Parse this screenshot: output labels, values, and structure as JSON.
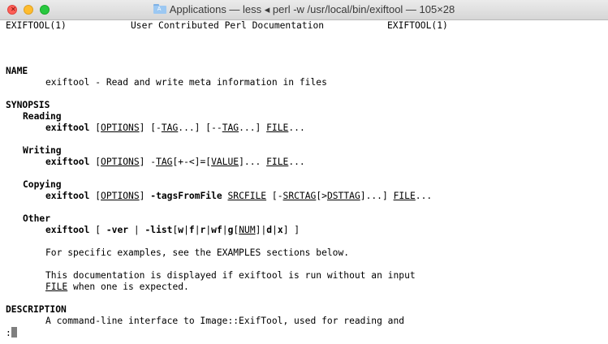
{
  "window": {
    "title": "Applications — less ◂ perl -w /usr/local/bin/exiftool — 105×28"
  },
  "terminal": {
    "header_left": "EXIFTOOL(1)",
    "header_center": "User Contributed Perl Documentation",
    "header_right": "EXIFTOOL(1)",
    "name_heading": "NAME",
    "name_text": "exiftool - Read and write meta information in files",
    "synopsis_heading": "SYNOPSIS",
    "reading": {
      "subheading": "Reading",
      "cmd": "exiftool",
      "open1": "[",
      "options": "OPTIONS",
      "close1": "] [-",
      "tag": "TAG",
      "mid": "...] [--",
      "tag2": "TAG",
      "mid2": "...] ",
      "file": "FILE",
      "end": "..."
    },
    "writing": {
      "subheading": "Writing",
      "cmd": "exiftool",
      "open1": "[",
      "options": "OPTIONS",
      "close1": "] -",
      "tag": "TAG",
      "mid": "[+-<]=[",
      "value": "VALUE",
      "mid2": "]... ",
      "file": "FILE",
      "end": "..."
    },
    "copying": {
      "subheading": "Copying",
      "cmd": "exiftool",
      "open1": "[",
      "options": "OPTIONS",
      "close1": "] ",
      "flag": "-tagsFromFile",
      "srcfile": "SRCFILE",
      "mid": "[-",
      "srctag": "SRCTAG",
      "mid2": "[>",
      "dsttag": "DSTTAG",
      "mid3": "]...] ",
      "file": "FILE",
      "end": "..."
    },
    "other": {
      "subheading": "Other",
      "cmd": "exiftool",
      "open1": "[ ",
      "ver": "-ver",
      "pipe": " | ",
      "list": "-list",
      "bracket_open": "[",
      "w": "w",
      "f": "f",
      "r": "r",
      "wf": "wf",
      "g": "g",
      "num": "NUM",
      "d": "d",
      "x": "x",
      "sep": "|",
      "bracket_open2": "[",
      "bracket_close2": "]",
      "bracket_close": "] ]"
    },
    "examples_note": "For specific examples, see the EXAMPLES sections below.",
    "doc_note_1": "This documentation is displayed if exiftool is run without an input",
    "doc_note_2_file": "FILE",
    "doc_note_2_rest": " when one is expected.",
    "description_heading": "DESCRIPTION",
    "description_text": "A command-line interface to Image::ExifTool, used for reading and",
    "prompt": ":"
  }
}
